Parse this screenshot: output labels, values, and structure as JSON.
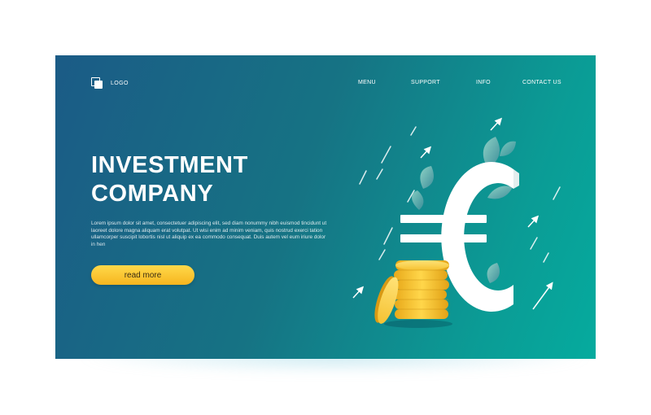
{
  "nav": {
    "logo_text": "LOGO",
    "items": [
      "MENU",
      "SUPPORT",
      "INFO",
      "CONTACT US"
    ]
  },
  "hero": {
    "title_line1": "INVESTMENT",
    "title_line2": "COMPANY",
    "body": "Lorem ipsum dolor sit amet, consectetuer adipiscing elit, sed diam nonummy nibh euismod tincidunt ut laoreet dolore magna aliquam erat volutpat. Ut wisi enim ad minim veniam, quis nostrud exerci tation ullamcorper suscipit lobortis nisl ut aliquip ex ea commodo consequat. Duis autem vel eum iriure dolor in hen",
    "cta_label": "read more"
  },
  "illustration": {
    "symbol": "€",
    "icons": [
      "euro-sign-icon",
      "coin-stack-icon",
      "leaf-icon",
      "arrow-up-right-icon"
    ]
  },
  "colors": {
    "bg_start": "#1b5b86",
    "bg_end": "#05ab9e",
    "cta": "#f6c12a",
    "coin": "#f0c12a"
  }
}
